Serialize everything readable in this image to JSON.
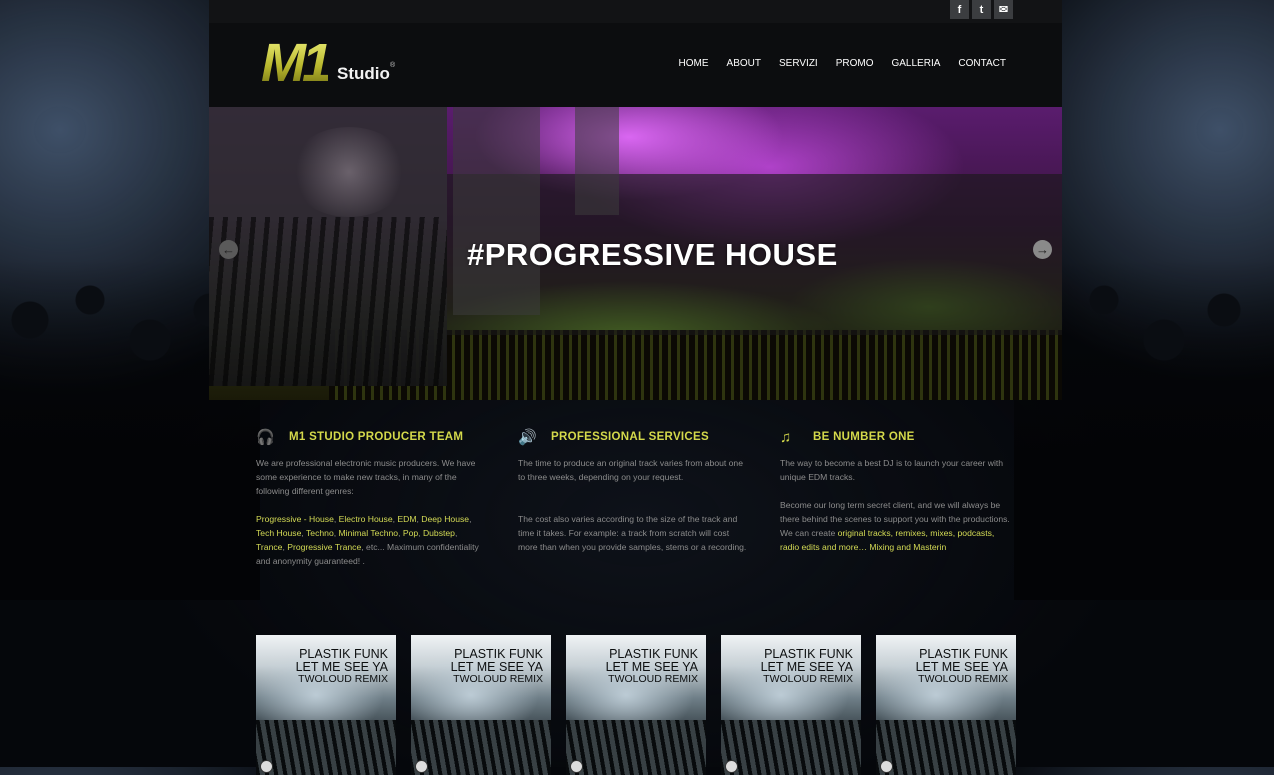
{
  "social": {
    "facebook_glyph": "f",
    "twitter_glyph": "t",
    "mail_glyph": "✉"
  },
  "logo": {
    "main": "M1",
    "sub": "Studio",
    "reg": "®"
  },
  "nav": [
    "HOME",
    "ABOUT",
    "SERVIZI",
    "PROMO",
    "GALLERIA",
    "CONTACT"
  ],
  "slider": {
    "title": "#PROGRESSIVE HOUSE",
    "prev_glyph": "←",
    "next_glyph": "→"
  },
  "features": [
    {
      "icon": "headphones-icon",
      "icon_glyph": "🎧",
      "title": "M1 STUDIO PRODUCER TEAM",
      "p1": "We are professional electronic music producers. We have some experience to make new tracks, in many of the following different genres:",
      "genres_html": [
        "Progressive - House",
        "Electro House",
        "EDM",
        "Deep House",
        "Tech House",
        "Techno",
        "Minimal Techno",
        "Pop",
        "Dubstep",
        "Trance",
        "Progressive Trance"
      ],
      "p2_tail": ", etc... Maximum confidentiality and anonymity guaranteed! ."
    },
    {
      "icon": "speaker-icon",
      "icon_glyph": "🔊",
      "title": "PROFESSIONAL SERVICES",
      "p1": "The time to produce an original track varies from about one to three weeks, depending on your request.",
      "p2": "The cost also varies according to the size of the track and time it takes. For example: a track from scratch will cost more than when you provide samples, stems or a recording."
    },
    {
      "icon": "music-note-icon",
      "icon_glyph": "♫",
      "title": "BE NUMBER ONE",
      "p1": "The way to become a best DJ is to launch your career with unique EDM tracks.",
      "p2": "Become our long term secret client, and we will always be there behind the scenes to support you with the productions. We can create ",
      "p2_highlight": "original tracks, remixes, mixes, podcasts, radio edits and more… Mixing and Masterin"
    }
  ],
  "covers": [
    {
      "line1": "PLASTIK FUNK",
      "line2": "LET ME SEE YA",
      "line3": "TWOLOUD REMIX"
    },
    {
      "line1": "PLASTIK FUNK",
      "line2": "LET ME SEE YA",
      "line3": "TWOLOUD REMIX"
    },
    {
      "line1": "PLASTIK FUNK",
      "line2": "LET ME SEE YA",
      "line3": "TWOLOUD REMIX"
    },
    {
      "line1": "PLASTIK FUNK",
      "line2": "LET ME SEE YA",
      "line3": "TWOLOUD REMIX"
    },
    {
      "line1": "PLASTIK FUNK",
      "line2": "LET ME SEE YA",
      "line3": "TWOLOUD REMIX"
    }
  ],
  "colors": {
    "accent": "#d4d94b",
    "body_text": "#8c8c8c",
    "header_bg": "#0c0d0f"
  }
}
